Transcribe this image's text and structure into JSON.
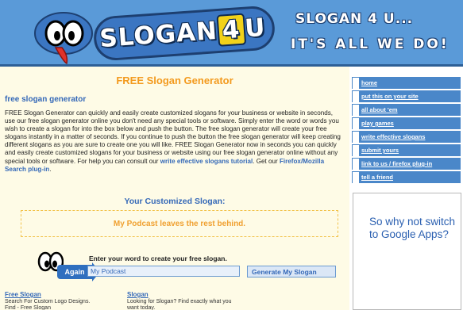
{
  "header": {
    "logo_text_a": "SLOGAN",
    "logo_text_num": "4",
    "logo_text_b": "U",
    "tagline_line1": "SLOGAN 4 U...",
    "tagline_line2": "IT'S ALL WE DO!"
  },
  "main": {
    "title": "FREE Slogan Generator",
    "subtitle": "free slogan generator",
    "intro": "FREE Slogan Generator can quickly and easily create customized slogans for your business or website in seconds, use our free slogan generator online you don't need any special tools or software. Simply enter the word or words you wish to create a slogan for into the box below and push the button. The free slogan generator will create your free slogans instantly in a matter of seconds. If you continue to push the button the free slogan generator will keep creating different slogans as you are sure to create one you will like. FREE Slogan Generator now in seconds you can quickly and easily create customized slogans for your business or website using our free slogan generator online without any special tools or software. For help you can consult our",
    "link_tutorial": "write effective slogans tutorial",
    "intro_mid": ". Get our",
    "link_plugin": "Firefox/Mozilla Search plug-in",
    "intro_end": ".",
    "custom_title": "Your Customized Slogan:",
    "slogan": "My Podcast leaves the rest behind.",
    "again_label": "Again",
    "enter_label": "Enter your word to create your free slogan.",
    "input_value": "My Podcast",
    "button_label": "Generate My Slogan"
  },
  "ads": [
    {
      "title": "Free Slogan",
      "text": "Search For Custom Logo Designs. Find - Free Slogan"
    },
    {
      "title": "Slogan",
      "text": "Looking for Slogan? Find exactly what you want today."
    }
  ],
  "menu": {
    "items": [
      "home",
      "put this on your site",
      "all about 'em",
      "play games",
      "write effective slogans",
      "submit yours",
      "link to us / firefox plug-in",
      "tell a friend"
    ]
  },
  "google_ad": {
    "text": "So why not switch to Google Apps?"
  },
  "colors": {
    "header_bg": "#5a9ad8",
    "panel_bg": "#fefbe6",
    "accent_orange": "#f39a1e",
    "link_blue": "#3569b8",
    "menu_blue": "#4a87c9"
  }
}
